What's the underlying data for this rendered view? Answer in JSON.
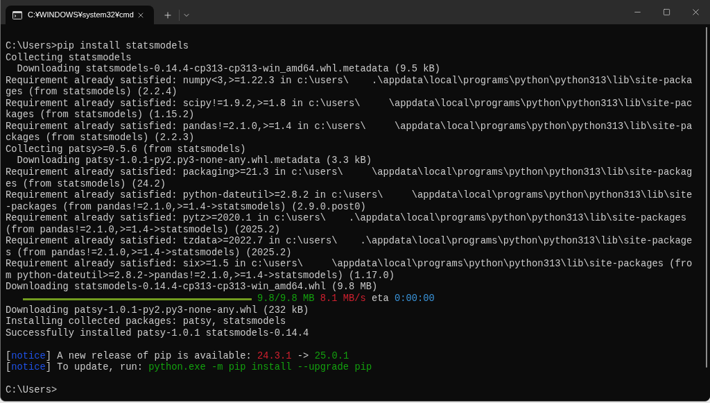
{
  "window": {
    "tabs": [
      {
        "title": "C:¥WINDOWS¥system32¥cmd",
        "selected": true
      }
    ]
  },
  "terminal": {
    "lines": [
      {
        "kind": "prompt",
        "text": "C:\\Users>pip install statsmodels"
      },
      {
        "kind": "text",
        "text": "Collecting statsmodels"
      },
      {
        "kind": "detail",
        "text": "Downloading statsmodels-0.14.4-cp313-cp313-win_amd64.whl.metadata (9.5 kB)"
      },
      {
        "kind": "text",
        "text": "Requirement already satisfied: numpy<3,>=1.22.3 in c:\\users\\    .\\appdata\\local\\programs\\python\\python313\\lib\\site-packa"
      },
      {
        "kind": "text",
        "text": "ges (from statsmodels) (2.2.4)"
      },
      {
        "kind": "text",
        "text": "Requirement already satisfied: scipy!=1.9.2,>=1.8 in c:\\users\\     \\appdata\\local\\programs\\python\\python313\\lib\\site-pac"
      },
      {
        "kind": "text",
        "text": "kages (from statsmodels) (1.15.2)"
      },
      {
        "kind": "text",
        "text": "Requirement already satisfied: pandas!=2.1.0,>=1.4 in c:\\users\\     \\appdata\\local\\programs\\python\\python313\\lib\\site-pa"
      },
      {
        "kind": "text",
        "text": "ckages (from statsmodels) (2.2.3)"
      },
      {
        "kind": "text",
        "text": "Collecting patsy>=0.5.6 (from statsmodels)"
      },
      {
        "kind": "detail",
        "text": "Downloading patsy-1.0.1-py2.py3-none-any.whl.metadata (3.3 kB)"
      },
      {
        "kind": "text",
        "text": "Requirement already satisfied: packaging>=21.3 in c:\\users\\     \\appdata\\local\\programs\\python\\python313\\lib\\site-packag"
      },
      {
        "kind": "text",
        "text": "es (from statsmodels) (24.2)"
      },
      {
        "kind": "text",
        "text": "Requirement already satisfied: python-dateutil>=2.8.2 in c:\\users\\     \\appdata\\local\\programs\\python\\python313\\lib\\site"
      },
      {
        "kind": "text",
        "text": "-packages (from pandas!=2.1.0,>=1.4->statsmodels) (2.9.0.post0)"
      },
      {
        "kind": "text",
        "text": "Requirement already satisfied: pytz>=2020.1 in c:\\users\\    .\\appdata\\local\\programs\\python\\python313\\lib\\site-packages"
      },
      {
        "kind": "text",
        "text": "(from pandas!=2.1.0,>=1.4->statsmodels) (2025.2)"
      },
      {
        "kind": "text",
        "text": "Requirement already satisfied: tzdata>=2022.7 in c:\\users\\    .\\appdata\\local\\programs\\python\\python313\\lib\\site-package"
      },
      {
        "kind": "text",
        "text": "s (from pandas!=2.1.0,>=1.4->statsmodels) (2025.2)"
      },
      {
        "kind": "text",
        "text": "Requirement already satisfied: six>=1.5 in c:\\users\\     \\appdata\\local\\programs\\python\\python313\\lib\\site-packages (fro"
      },
      {
        "kind": "text",
        "text": "m python-dateutil>=2.8.2->pandas!=2.1.0,>=1.4->statsmodels) (1.17.0)"
      },
      {
        "kind": "text",
        "text": "Downloading statsmodels-0.14.4-cp313-cp313-win_amd64.whl (9.8 MB)"
      },
      {
        "kind": "progress",
        "level": 1,
        "downloaded": "9.8/9.8 MB",
        "speed": "8.1 MB/s",
        "eta_label": "eta",
        "eta": "0:00:00"
      },
      {
        "kind": "text",
        "text": "Downloading patsy-1.0.1-py2.py3-none-any.whl (232 kB)"
      },
      {
        "kind": "text",
        "text": "Installing collected packages: patsy, statsmodels"
      },
      {
        "kind": "text",
        "text": "Successfully installed patsy-1.0.1 statsmodels-0.14.4"
      },
      {
        "kind": "blank"
      },
      {
        "kind": "notice",
        "open": "[",
        "tag": "notice",
        "close": "]",
        "message": "A new release of pip is available:",
        "current": "24.3.1",
        "arrow": "->",
        "latest": "25.0.1"
      },
      {
        "kind": "notice",
        "open": "[",
        "tag": "notice",
        "close": "]",
        "message": "To update, run:",
        "command": "python.exe -m pip install --upgrade pip"
      },
      {
        "kind": "blank"
      },
      {
        "kind": "prompt",
        "text": "C:\\Users>"
      }
    ]
  }
}
